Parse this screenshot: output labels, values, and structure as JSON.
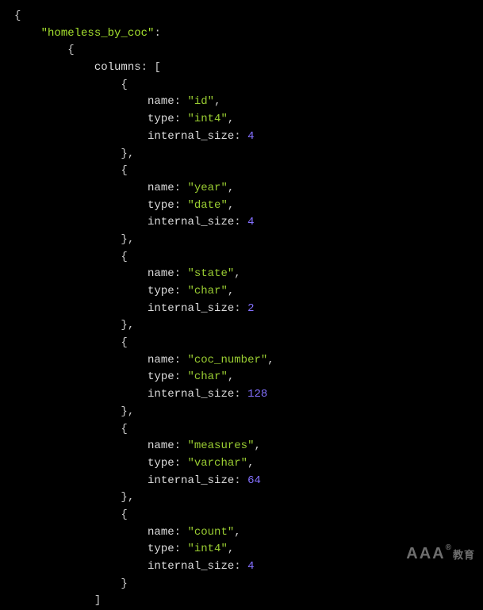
{
  "table_key": "homeless_by_coc",
  "columns_label": "columns",
  "name_label": "name",
  "type_label": "type",
  "size_label": "internal_size",
  "cols": [
    {
      "name": "id",
      "type": "int4",
      "size": 4
    },
    {
      "name": "year",
      "type": "date",
      "size": 4
    },
    {
      "name": "state",
      "type": "char",
      "size": 2
    },
    {
      "name": "coc_number",
      "type": "char",
      "size": 128
    },
    {
      "name": "measures",
      "type": "varchar",
      "size": 64
    },
    {
      "name": "count",
      "type": "int4",
      "size": 4
    }
  ],
  "watermark": {
    "brand": "AAA",
    "suffix": "教育"
  }
}
